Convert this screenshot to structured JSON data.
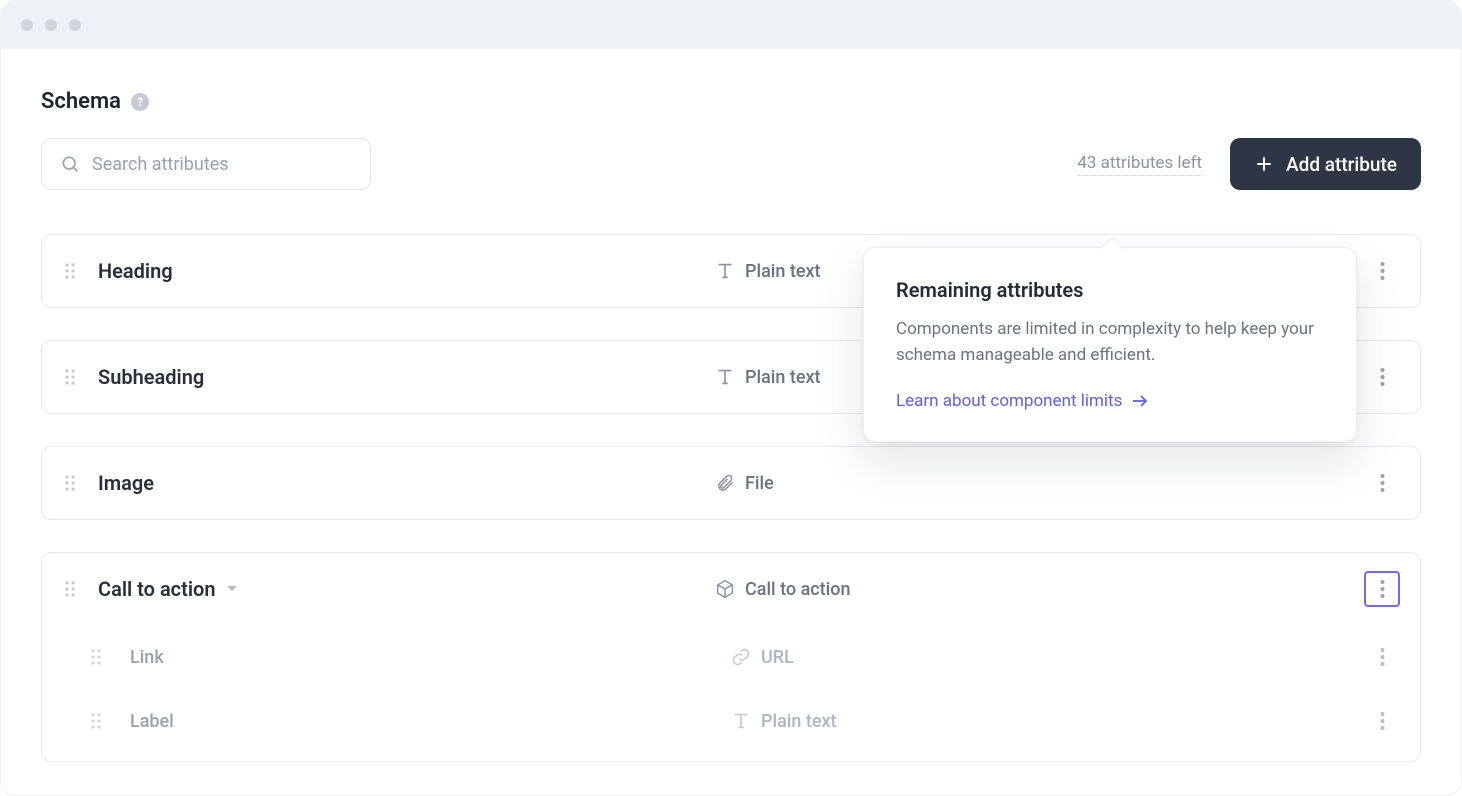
{
  "page": {
    "title": "Schema"
  },
  "search": {
    "placeholder": "Search attributes"
  },
  "toolbar": {
    "attributes_left": "43 attributes left",
    "add_button": "Add attribute"
  },
  "popover": {
    "title": "Remaining attributes",
    "body": "Components are limited in complexity to help keep your schema manageable and efficient.",
    "link": "Learn about component limits"
  },
  "attributes": [
    {
      "name": "Heading",
      "type": "Plain text",
      "type_icon": "text"
    },
    {
      "name": "Subheading",
      "type": "Plain text",
      "type_icon": "text"
    },
    {
      "name": "Image",
      "type": "File",
      "type_icon": "file"
    },
    {
      "name": "Call to action",
      "type": "Call to action",
      "type_icon": "component",
      "expanded": true,
      "children": [
        {
          "name": "Link",
          "type": "URL",
          "type_icon": "url"
        },
        {
          "name": "Label",
          "type": "Plain text",
          "type_icon": "text"
        }
      ]
    }
  ]
}
